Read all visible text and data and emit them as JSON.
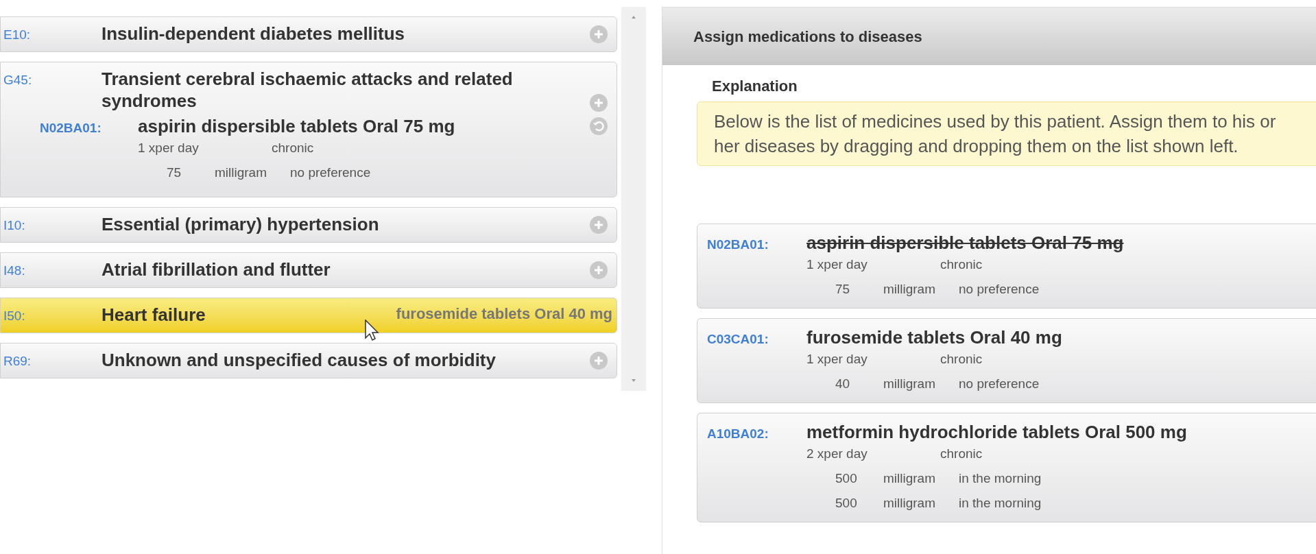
{
  "diseases": [
    {
      "code": "E10:",
      "name": "Insulin-dependent diabetes mellitus",
      "highlighted": false
    },
    {
      "code": "G45:",
      "name": "Transient cerebral ischaemic attacks and related syndromes",
      "highlighted": false,
      "medications": [
        {
          "code": "N02BA01:",
          "name": "aspirin dispersible tablets Oral 75 mg",
          "frequency": "1 xper day",
          "duration": "chronic",
          "doses": [
            {
              "amount": "75",
              "unit": "milligram",
              "timing": "no preference"
            }
          ]
        }
      ]
    },
    {
      "code": "I10:",
      "name": "Essential (primary) hypertension",
      "highlighted": false
    },
    {
      "code": "I48:",
      "name": "Atrial fibrillation and flutter",
      "highlighted": false
    },
    {
      "code": "I50:",
      "name": "Heart failure",
      "highlighted": true
    },
    {
      "code": "R69:",
      "name": "Unknown and unspecified causes of morbidity",
      "highlighted": false
    }
  ],
  "drag_label": "furosemide tablets Oral 40 mg",
  "panel": {
    "title": "Assign medications to diseases",
    "explanation_heading": "Explanation",
    "explanation": "Below is the list of medicines used by this patient. Assign them to his or her diseases by dragging and dropping them on the list shown left.",
    "medications": [
      {
        "code": "N02BA01:",
        "name": "aspirin dispersible tablets Oral 75 mg",
        "assigned": true,
        "frequency": "1 xper day",
        "duration": "chronic",
        "doses": [
          {
            "amount": "75",
            "unit": "milligram",
            "timing": "no preference"
          }
        ]
      },
      {
        "code": "C03CA01:",
        "name": "furosemide tablets Oral 40 mg",
        "assigned": false,
        "frequency": "1 xper day",
        "duration": "chronic",
        "doses": [
          {
            "amount": "40",
            "unit": "milligram",
            "timing": "no preference"
          }
        ]
      },
      {
        "code": "A10BA02:",
        "name": "metformin hydrochloride tablets Oral 500 mg",
        "assigned": false,
        "frequency": "2 xper day",
        "duration": "chronic",
        "doses": [
          {
            "amount": "500",
            "unit": "milligram",
            "timing": "in the morning"
          },
          {
            "amount": "500",
            "unit": "milligram",
            "timing": "in the morning"
          }
        ]
      }
    ]
  }
}
